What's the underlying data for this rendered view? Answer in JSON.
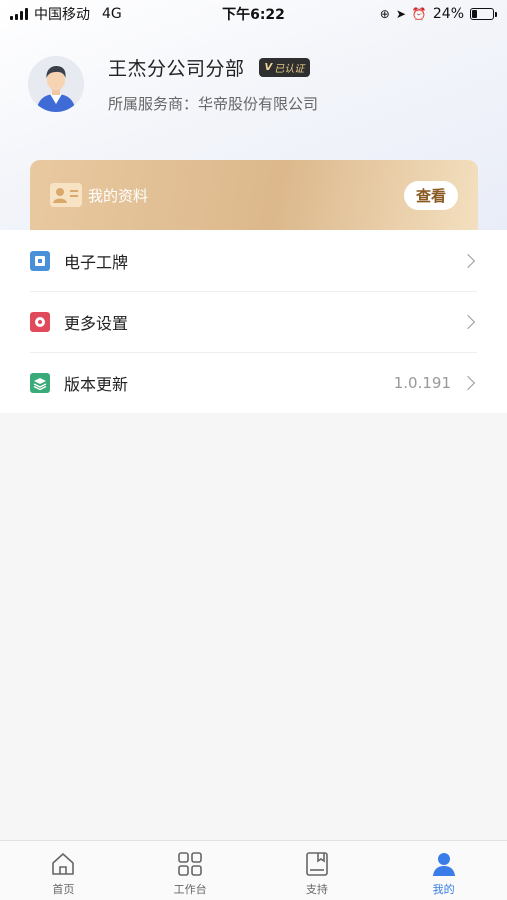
{
  "status_bar": {
    "carrier": "中国移动",
    "network": "4G",
    "time": "下午6:22",
    "battery": "24%",
    "battery_level": 0.24
  },
  "profile": {
    "name": "王杰分公司分部",
    "badge": "已认证",
    "badge_mark": "V",
    "provider": "所属服务商：华帝股份有限公司"
  },
  "profile_card": {
    "title": "我的资料",
    "view_label": "查看"
  },
  "menu": {
    "items": [
      {
        "label": "电子工牌",
        "value": "",
        "icon": "badge-card-icon",
        "color": "#4a90d9"
      },
      {
        "label": "更多设置",
        "value": "",
        "icon": "settings-icon",
        "color": "#e04a5a"
      },
      {
        "label": "版本更新",
        "value": "1.0.191",
        "icon": "layers-icon",
        "color": "#3aaa7a"
      }
    ]
  },
  "tabbar": {
    "items": [
      {
        "label": "首页",
        "icon": "home-icon"
      },
      {
        "label": "工作台",
        "icon": "grid-icon"
      },
      {
        "label": "支持",
        "icon": "book-icon"
      },
      {
        "label": "我的",
        "icon": "user-icon"
      }
    ],
    "active_color": "#3b7de8"
  }
}
